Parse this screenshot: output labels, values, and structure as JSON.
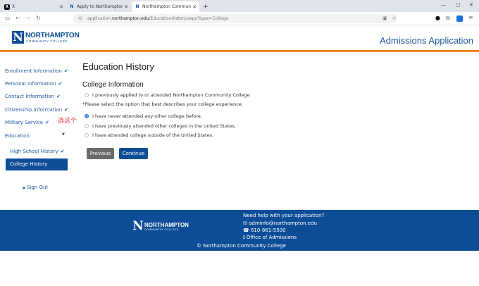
{
  "browser": {
    "tabs": [
      {
        "icon": "X",
        "title": "X",
        "active": false
      },
      {
        "icon": "N",
        "title": "Apply to Northampton Comm",
        "active": false
      },
      {
        "icon": "N",
        "title": "Northampton Community Coll",
        "active": true
      }
    ],
    "new_tab": "+",
    "url_prefix": "application.",
    "url_domain": "northampton.edu",
    "url_path": "/EducationHistory.aspx?type=College"
  },
  "header": {
    "logo_title": "NORTHAMPTON",
    "logo_sub": "COMMUNITY COLLEGE",
    "app_title": "Admissions Application"
  },
  "sidebar": {
    "items": [
      {
        "label": "Enrollment Information",
        "check": "✔"
      },
      {
        "label": "Personal Information",
        "check": "✔"
      },
      {
        "label": "Contact Information",
        "check": "✔"
      },
      {
        "label": "Citizenship Information",
        "check": "✔"
      },
      {
        "label": "Military Service",
        "check": "✔"
      },
      {
        "label": "Education",
        "check": ""
      }
    ],
    "sub_items": [
      {
        "label": "High School History",
        "check": "✔"
      },
      {
        "label": "College History",
        "active": true
      }
    ],
    "annotation": "选这个",
    "sign_out": "Sign Out"
  },
  "main": {
    "title": "Education History",
    "section_title": "College Information",
    "previously_attended": "I previously applied to or attended Northampton Community College",
    "prompt": "*Please select the option that best describes your college experience:",
    "options": [
      {
        "label": "I have never attended any other college before.",
        "selected": true
      },
      {
        "label": "I have previously attended other colleges in the United States.",
        "selected": false
      },
      {
        "label": "I have attended college outside of the United States.",
        "selected": false
      }
    ],
    "previous_label": "Previous",
    "continue_label": "Continue"
  },
  "footer": {
    "logo_title": "NORTHAMPTON",
    "logo_sub": "COMMUNITY COLLEGE",
    "help": "Need help with your application?",
    "email": "adminfo@northampton.edu",
    "phone": "610-861-5500",
    "office": "Office of Admissions",
    "copyright": "© Northampton Community College"
  },
  "colors": {
    "brand_blue": "#0d4d97",
    "accent_orange": "#f08a1c",
    "button_gray": "#6b6b6b"
  }
}
